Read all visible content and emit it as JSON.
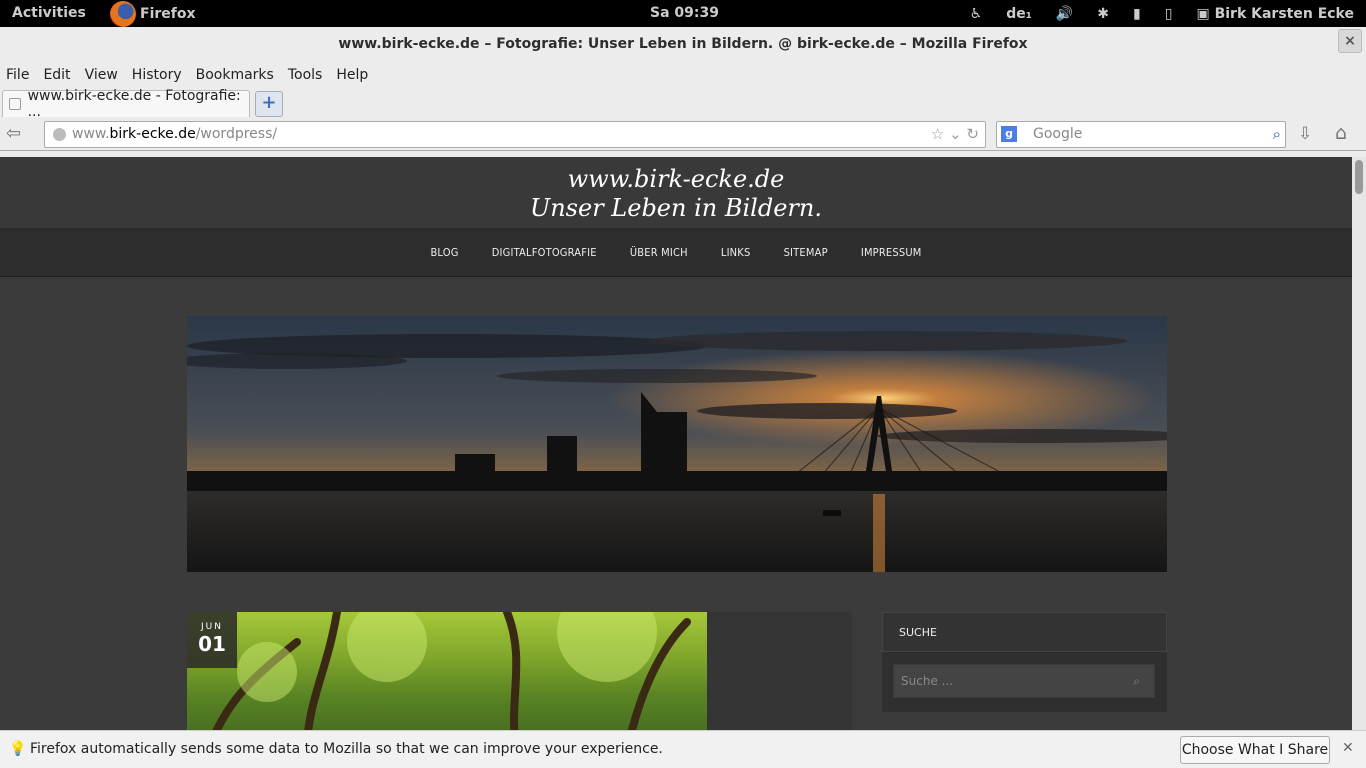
{
  "system": {
    "activities": "Activities",
    "app_name": "Firefox",
    "clock": "Sa 09:39",
    "keyboard_layout": "de₁",
    "user_name": "Birk Karsten Ecke"
  },
  "window": {
    "title": "www.birk-ecke.de – Fotografie: Unser Leben in Bildern. @ birk-ecke.de – Mozilla Firefox",
    "close_label": "×"
  },
  "menu": [
    "File",
    "Edit",
    "View",
    "History",
    "Bookmarks",
    "Tools",
    "Help"
  ],
  "tab": {
    "title": "www.birk-ecke.de - Fotografie: ...",
    "new_tab_label": "+"
  },
  "urlbar": {
    "prefix": "www.",
    "host": "birk-ecke.de",
    "path": "/wordpress/"
  },
  "search": {
    "placeholder": "Google"
  },
  "site": {
    "title": "www.birk-ecke.de",
    "description": "Unser Leben in Bildern.",
    "nav": [
      "BLOG",
      "DIGITALFOTOGRAFIE",
      "ÜBER MICH",
      "LINKS",
      "SITEMAP",
      "IMPRESSUM"
    ]
  },
  "post": {
    "month": "JUN",
    "day": "01"
  },
  "widget": {
    "title": "SUCHE",
    "search_placeholder": "Suche ..."
  },
  "notification": {
    "message": "Firefox automatically sends some data to Mozilla so that we can improve your experience.",
    "button": "Choose What I Share"
  }
}
